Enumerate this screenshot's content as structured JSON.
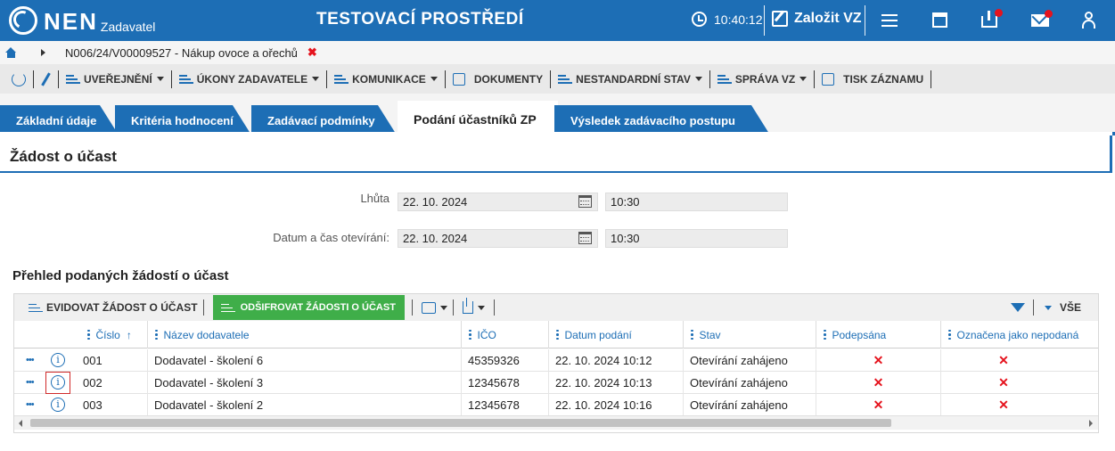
{
  "header": {
    "logo_text": "NEN",
    "logo_sub": "Zadavatel",
    "environment": "TESTOVACÍ PROSTŘEDÍ",
    "time": "10:40:12",
    "new_vz": "Založit VZ"
  },
  "breadcrumb": {
    "path": "N006/24/V00009527 - Nákup ovoce a ořechů",
    "close_symbol": "✖"
  },
  "toolbar": {
    "items": [
      "UVEŘEJNĚNÍ",
      "ÚKONY ZADAVATELE",
      "KOMUNIKACE",
      "DOKUMENTY",
      "NESTANDARDNÍ STAV",
      "SPRÁVA VZ",
      "TISK ZÁZNAMU"
    ]
  },
  "tabs": [
    {
      "label": "Základní údaje"
    },
    {
      "label": "Kritéria hodnocení"
    },
    {
      "label": "Zadávací podmínky"
    },
    {
      "label": "Podání účastníků ZP",
      "active": true
    },
    {
      "label": "Výsledek zadávacího postupu"
    }
  ],
  "section": {
    "title": "Žádost o účast"
  },
  "form": {
    "deadline_label": "Lhůta",
    "deadline_date": "22. 10. 2024",
    "deadline_time": "10:30",
    "opening_label": "Datum a čas otevírání:",
    "opening_date": "22. 10. 2024",
    "opening_time": "10:30"
  },
  "grid": {
    "title": "Přehled podaných žádostí o účast",
    "toolbar": {
      "register": "EVIDOVAT ŽÁDOST O ÚČAST",
      "decrypt": "ODŠIFROVAT ŽÁDOSTI O ÚČAST",
      "all": "VŠE"
    },
    "columns": [
      "Číslo",
      "Název dodavatele",
      "IČO",
      "Datum podání",
      "Stav",
      "Podepsána",
      "Označena jako nepodaná"
    ],
    "sort_symbol": "↑",
    "rows": [
      {
        "cislo": "001",
        "nazev": "Dodavatel - školení 6",
        "ico": "45359326",
        "datum": "22. 10. 2024 10:12",
        "stav": "Otevírání zahájeno",
        "podepsana": "✕",
        "nepodana": "✕"
      },
      {
        "cislo": "002",
        "nazev": "Dodavatel - školení 3",
        "ico": "12345678",
        "datum": "22. 10. 2024 10:13",
        "stav": "Otevírání zahájeno",
        "podepsana": "✕",
        "nepodana": "✕"
      },
      {
        "cislo": "003",
        "nazev": "Dodavatel - školení 2",
        "ico": "12345678",
        "datum": "22. 10. 2024 10:16",
        "stav": "Otevírání zahájeno",
        "podepsana": "✕",
        "nepodana": "✕"
      }
    ],
    "row_menu": "•••",
    "info_symbol": "i"
  },
  "colors": {
    "primary": "#1d6eb5",
    "success": "#3fae49",
    "danger": "#e5131d"
  }
}
